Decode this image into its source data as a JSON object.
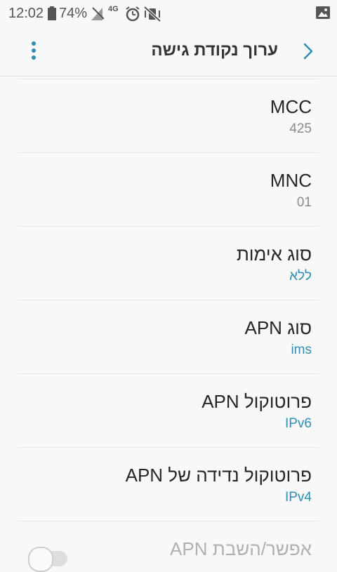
{
  "status_bar": {
    "time": "12:02",
    "battery": "74%",
    "network_type": "4G"
  },
  "header": {
    "title": "ערוך נקודת גישה"
  },
  "settings": [
    {
      "title": "MCC",
      "value": "425"
    },
    {
      "title": "MNC",
      "value": "01"
    },
    {
      "title": "סוג אימות",
      "value": "ללא"
    },
    {
      "title": "סוג APN",
      "value": "ims"
    },
    {
      "title": "פרוטוקול APN",
      "value": "IPv6"
    },
    {
      "title": "פרוטוקול נדידה של APN",
      "value": "IPv4"
    }
  ],
  "toggle_row": {
    "label": "אפשר/השבת APN",
    "enabled": false
  },
  "colors": {
    "accent": "#2f8fb2",
    "background": "#f8f8f8"
  }
}
